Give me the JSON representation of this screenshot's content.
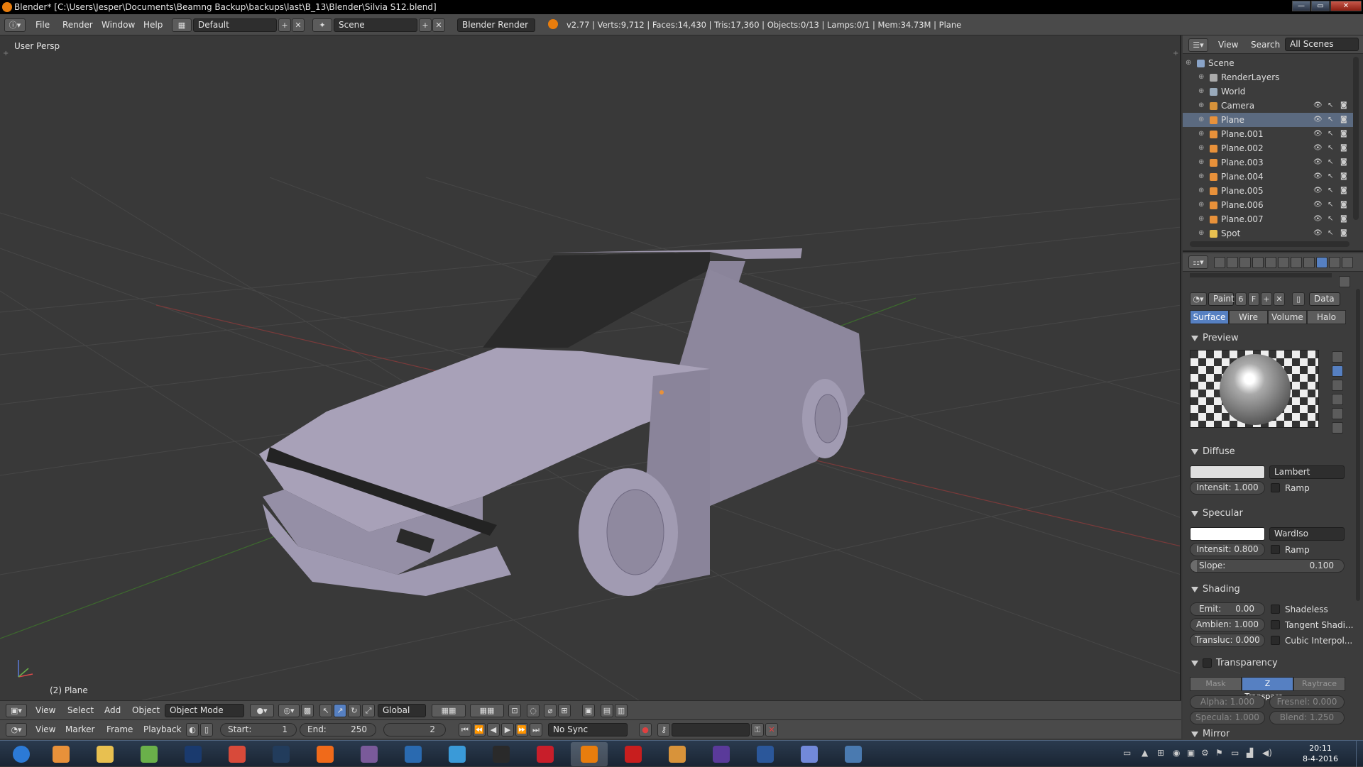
{
  "window": {
    "title": "Blender* [C:\\Users\\Jesper\\Documents\\Beamng Backup\\backups\\last\\B_13\\Blender\\Silvia S12.blend]",
    "minimize": "—",
    "maximize": "▭",
    "close": "✕"
  },
  "info_header": {
    "menus": [
      "File",
      "Render",
      "Window",
      "Help"
    ],
    "layout": "Default",
    "scene": "Scene",
    "engine": "Blender Render",
    "stats": "v2.77 | Verts:9,712 | Faces:14,430 | Tris:17,360 | Objects:0/13 | Lamps:0/1 | Mem:34.73M | Plane"
  },
  "viewport": {
    "view_name": "User Persp",
    "active_object": "(2) Plane",
    "header_menus": [
      "View",
      "Select",
      "Add",
      "Object"
    ],
    "mode": "Object Mode",
    "orientation": "Global"
  },
  "timeline": {
    "menus": [
      "View",
      "Marker",
      "Frame",
      "Playback"
    ],
    "start_label": "Start:",
    "start": "1",
    "end_label": "End:",
    "end": "250",
    "current": "2",
    "sync": "No Sync"
  },
  "outliner": {
    "header": {
      "view": "View",
      "search": "Search",
      "filter": "All Scenes"
    },
    "items": [
      {
        "label": "Scene",
        "indent": 0,
        "icon": "scene-icon"
      },
      {
        "label": "RenderLayers",
        "indent": 1,
        "icon": "renderlayers-icon"
      },
      {
        "label": "World",
        "indent": 1,
        "icon": "world-icon"
      },
      {
        "label": "Camera",
        "indent": 1,
        "icon": "camera-icon"
      },
      {
        "label": "Plane",
        "indent": 1,
        "icon": "mesh-icon",
        "selected": true
      },
      {
        "label": "Plane.001",
        "indent": 1,
        "icon": "mesh-icon"
      },
      {
        "label": "Plane.002",
        "indent": 1,
        "icon": "mesh-icon"
      },
      {
        "label": "Plane.003",
        "indent": 1,
        "icon": "mesh-icon"
      },
      {
        "label": "Plane.004",
        "indent": 1,
        "icon": "mesh-icon"
      },
      {
        "label": "Plane.005",
        "indent": 1,
        "icon": "mesh-icon"
      },
      {
        "label": "Plane.006",
        "indent": 1,
        "icon": "mesh-icon"
      },
      {
        "label": "Plane.007",
        "indent": 1,
        "icon": "mesh-icon"
      },
      {
        "label": "Spot",
        "indent": 1,
        "icon": "lamp-icon"
      }
    ]
  },
  "properties": {
    "material_name": "Paint",
    "users": "6",
    "fake_user": "F",
    "link": "Data",
    "tabs": [
      "Surface",
      "Wire",
      "Volume",
      "Halo"
    ],
    "active_tab": "Surface",
    "preview_title": "Preview",
    "diffuse": {
      "title": "Diffuse",
      "shader": "Lambert",
      "intensity": "Intensit: 1.000",
      "ramp": "Ramp",
      "color": "#e0e0e0"
    },
    "specular": {
      "title": "Specular",
      "shader": "WardIso",
      "intensity": "Intensit: 0.800",
      "ramp": "Ramp",
      "slope_label": "Slope:",
      "slope": "0.100",
      "color": "#ffffff"
    },
    "shading": {
      "title": "Shading",
      "emit": "Emit:",
      "emit_val": "0.00",
      "ambient": "Ambien: 1.000",
      "transluc": "Transluc: 0.000",
      "shadeless": "Shadeless",
      "tangent": "Tangent Shadi...",
      "cubic": "Cubic Interpol..."
    },
    "transparency": {
      "title": "Transparency",
      "modes": [
        "Mask",
        "Z Transpare...",
        "Raytrace"
      ],
      "alpha": "Alpha: 1.000",
      "fresnel": "Fresnel: 0.000",
      "specula": "Specula: 1.000",
      "blend": "Blend: 1.250"
    },
    "mirror_title": "Mirror"
  },
  "taskbar": {
    "time": "20:11",
    "date": "8-4-2016",
    "apps": [
      "start",
      "media-player",
      "file-explorer",
      "notepad-plus",
      "photoshop",
      "chrome",
      "steam",
      "origin",
      "blender-addon",
      "uplay",
      "remote",
      "obs",
      "solidworks",
      "blender",
      "autocad",
      "inventor",
      "visual-studio",
      "word",
      "discord",
      "window"
    ]
  }
}
